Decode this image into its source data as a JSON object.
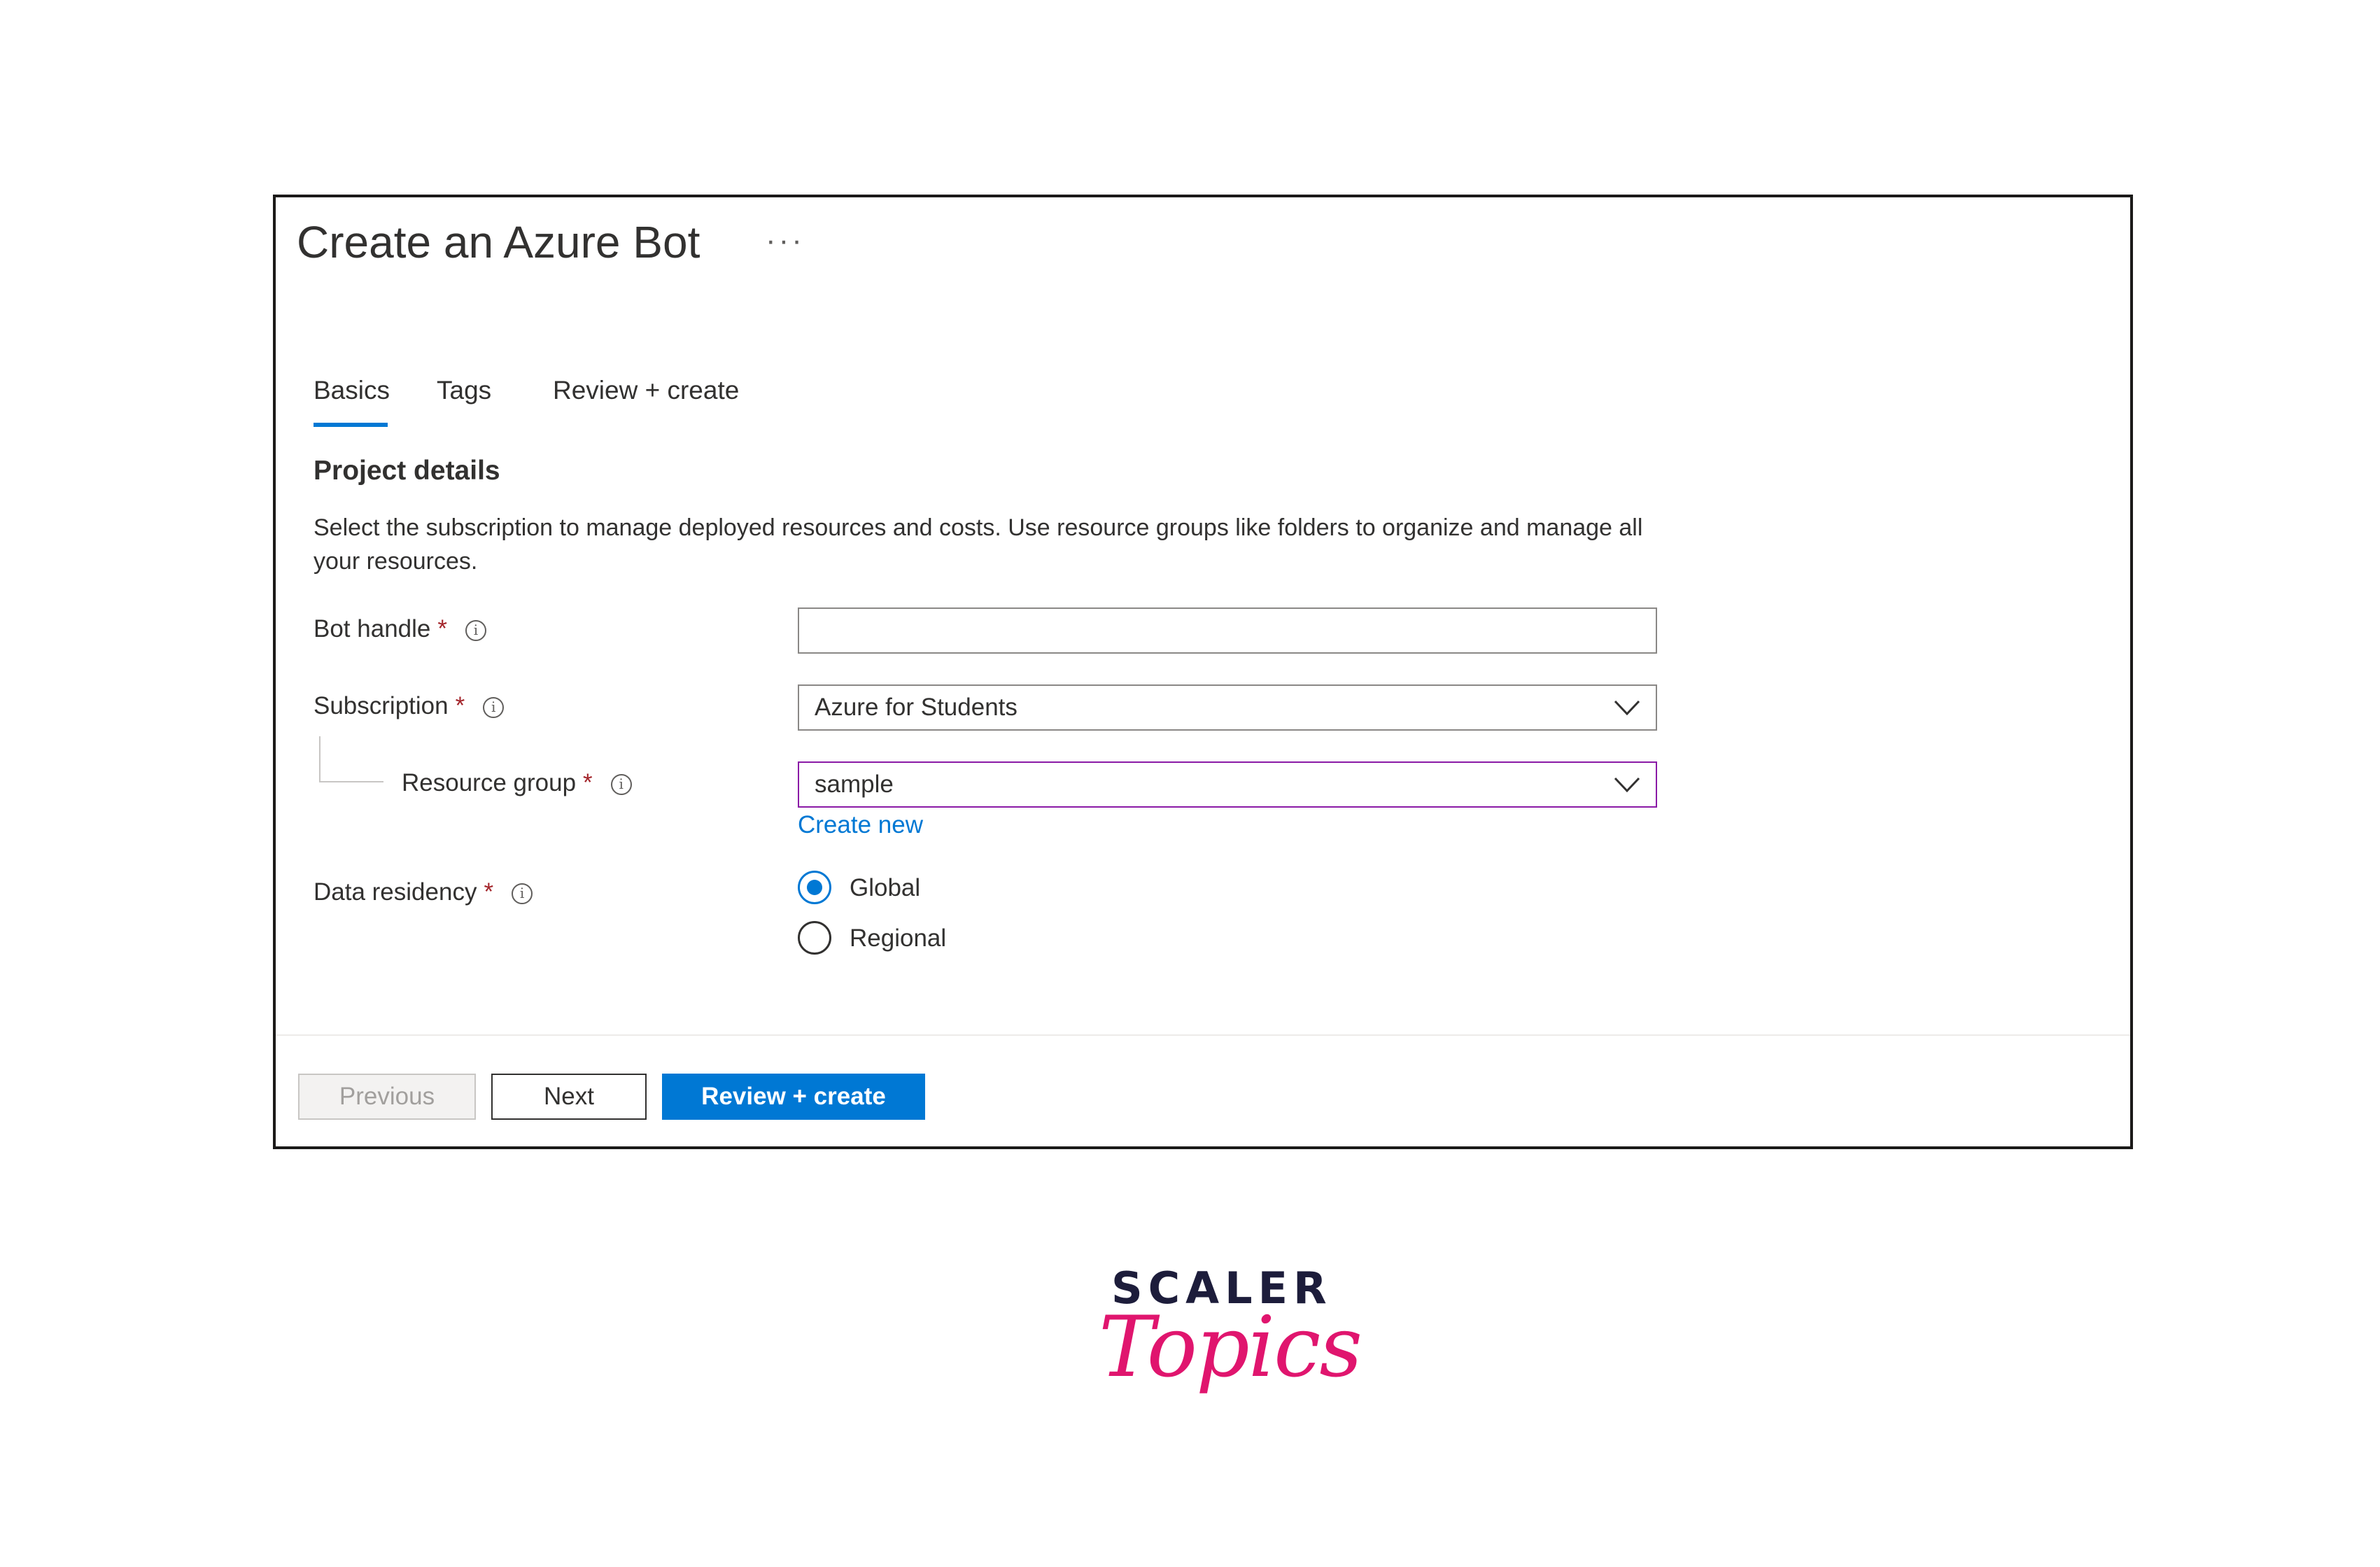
{
  "header": {
    "title": "Create an Azure Bot",
    "more_label": "···"
  },
  "tabs": [
    {
      "label": "Basics",
      "active": true
    },
    {
      "label": "Tags",
      "active": false
    },
    {
      "label": "Review + create",
      "active": false
    }
  ],
  "project_details": {
    "title": "Project details",
    "description": "Select the subscription to manage deployed resources and costs. Use resource groups like folders to organize and manage all your resources."
  },
  "fields": {
    "bot_handle": {
      "label": "Bot handle",
      "required": "*",
      "value": ""
    },
    "subscription": {
      "label": "Subscription",
      "required": "*",
      "value": "Azure for Students"
    },
    "resource_group": {
      "label": "Resource group",
      "required": "*",
      "value": "sample",
      "create_new": "Create new"
    },
    "data_residency": {
      "label": "Data residency",
      "required": "*",
      "options": [
        {
          "label": "Global",
          "checked": true
        },
        {
          "label": "Regional",
          "checked": false
        }
      ]
    }
  },
  "footer": {
    "previous_label": "Previous",
    "next_label": "Next",
    "review_label": "Review + create"
  },
  "logo": {
    "top": "SCALER",
    "bottom": "Topics"
  },
  "colors": {
    "accent": "#0078d4",
    "required": "#a4262c",
    "focus_border": "#8a1aa6",
    "logo_pink": "#e0156e",
    "logo_navy": "#1d1d3b"
  },
  "icons": {
    "info": "info-circle-icon",
    "chevron": "chevron-down-icon",
    "more": "more-ellipsis-icon"
  }
}
